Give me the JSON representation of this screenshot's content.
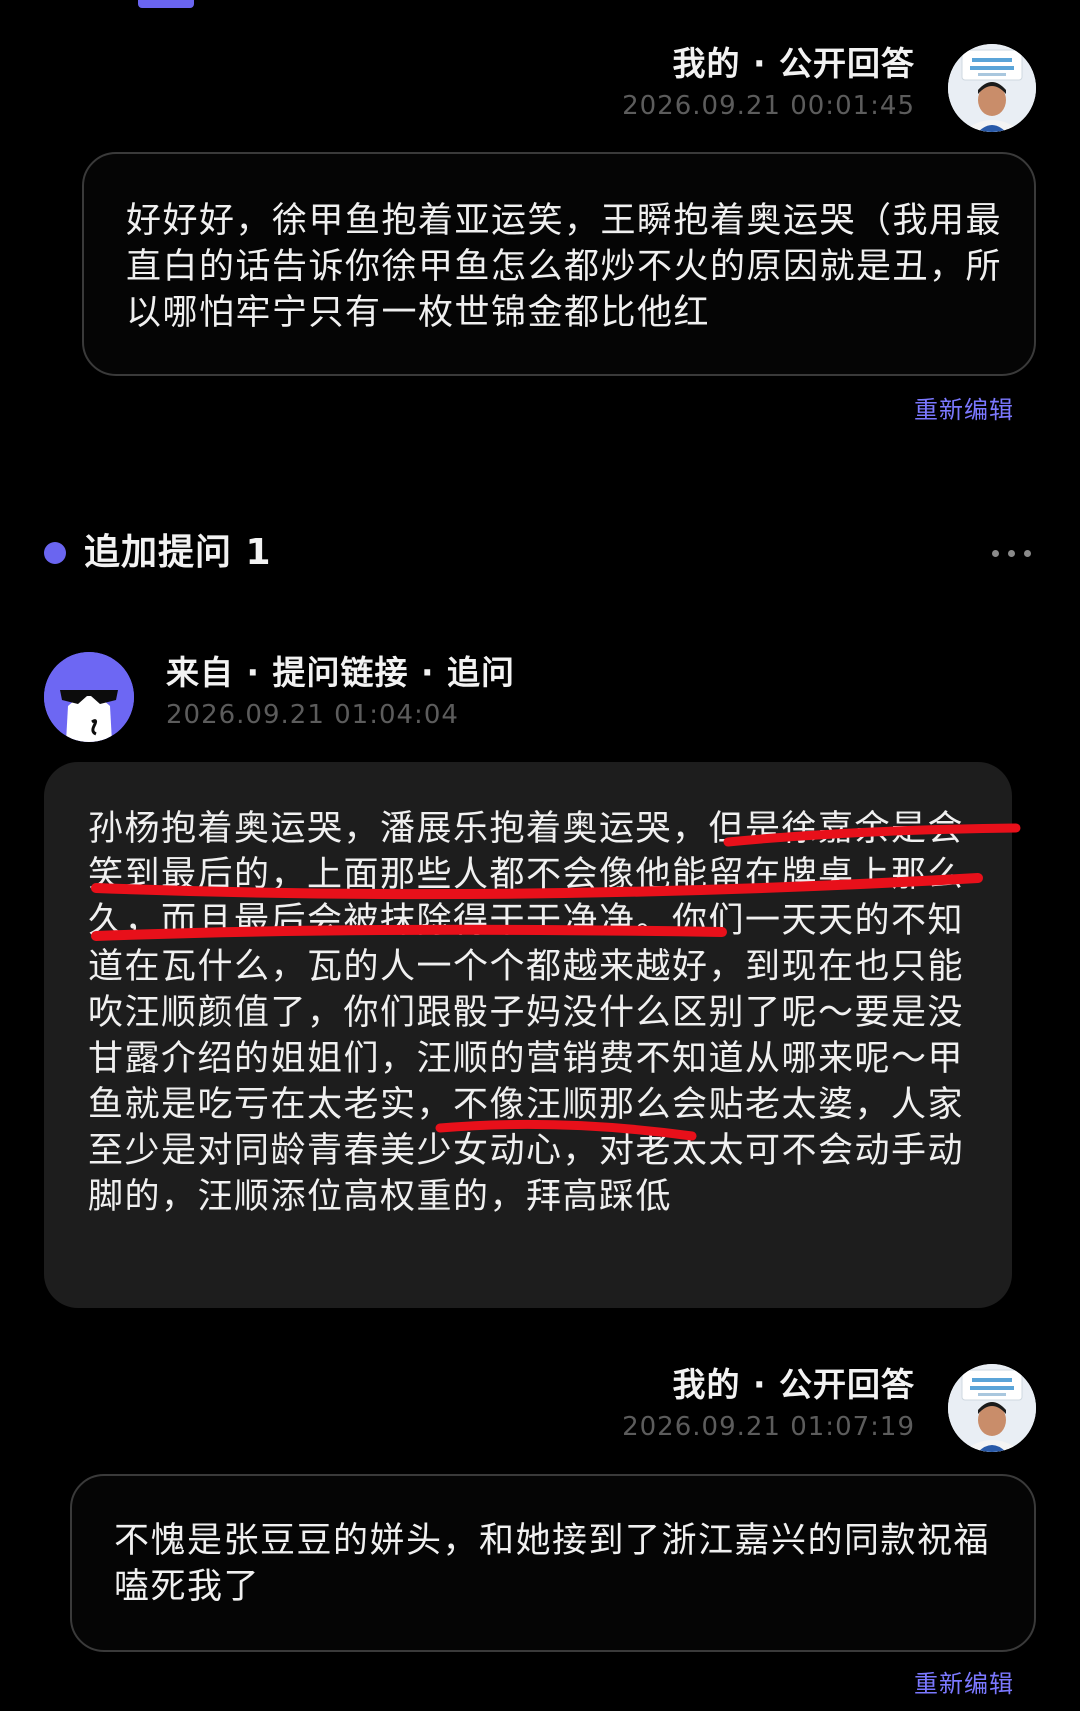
{
  "answer1": {
    "header_label": "我的 · 公开回答",
    "timestamp": "2026.09.21 00:01:45",
    "text": "好好好，徐甲鱼抱着亚运笑，王瞬抱着奥运哭（我用最直白的话告诉你徐甲鱼怎么都炒不火的原因就是丑，所以哪怕牢宁只有一枚世锦金都比他红",
    "reedit_label": "重新编辑"
  },
  "followup": {
    "title": "追加提问 1",
    "more_icon": "more-horizontal-icon"
  },
  "question": {
    "header_label": "来自 · 提问链接 · 追问",
    "timestamp": "2026.09.21 01:04:04",
    "text": "孙杨抱着奥运哭，潘展乐抱着奥运哭，但是徐嘉余是会笑到最后的，上面那些人都不会像他能留在牌桌上那么久，而且最后会被抹除得干干净净。你们一天天的不知道在瓦什么，瓦的人一个个都越来越好，到现在也只能吹汪顺颜值了，你们跟骰子妈没什么区别了呢～要是没甘露介绍的姐姐们，汪顺的营销费不知道从哪来呢～甲鱼就是吃亏在太老实，不像汪顺那么会贴老太婆，人家至少是对同龄青春美少女动心，对老太太可不会动手动脚的，汪顺添位高权重的，拜高踩低"
  },
  "answer2": {
    "header_label": "我的 · 公开回答",
    "timestamp": "2026.09.21 01:07:19",
    "text": "不愧是张豆豆的姘头，和她接到了浙江嘉兴的同款祝福嗑死我了",
    "reedit_label": "重新编辑"
  },
  "colors": {
    "accent": "#6a65f0",
    "link": "#7b78ff",
    "background": "#000000",
    "bubble_fill": "#1d1d1d",
    "annotation_red": "#e8101a"
  }
}
